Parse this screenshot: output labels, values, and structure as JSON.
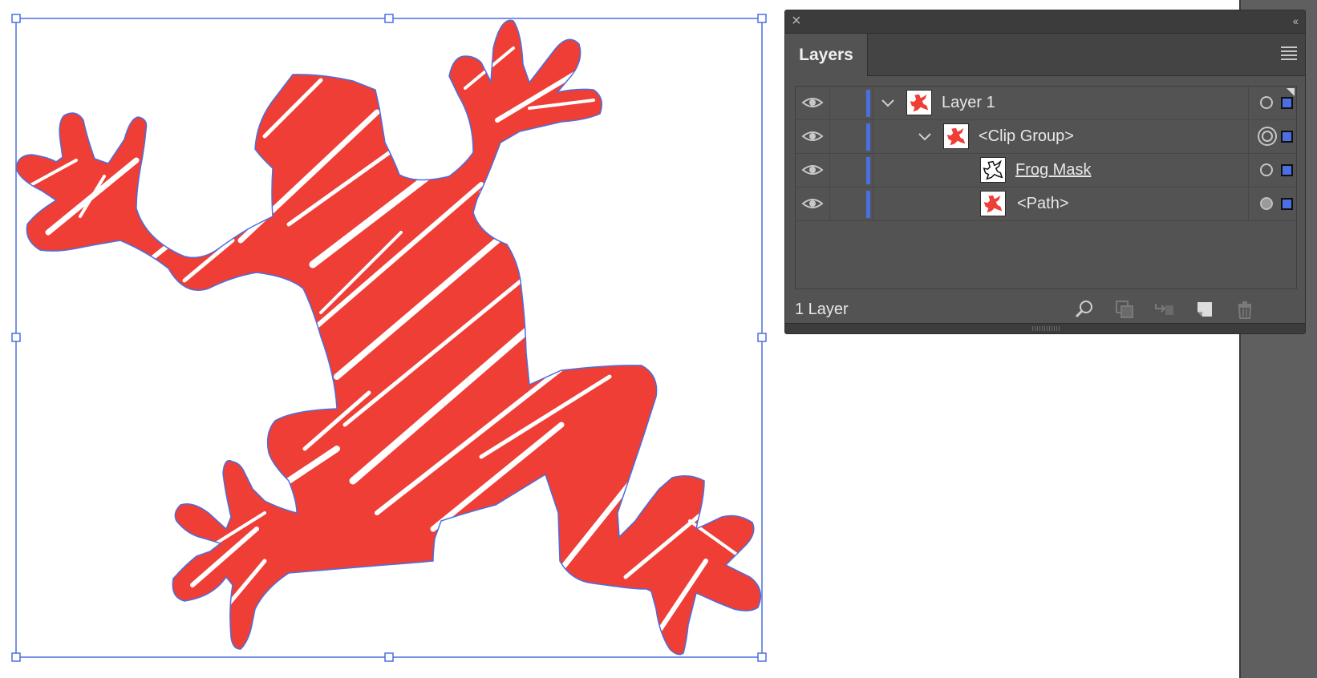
{
  "panel": {
    "tab_label": "Layers",
    "footer_count": "1 Layer",
    "layers": [
      {
        "label": "Layer 1",
        "level": 0,
        "expandable": true,
        "thumb": "frog-thumb",
        "target": "single",
        "corner_mark": true,
        "underline": false
      },
      {
        "label": "<Clip Group>",
        "level": 1,
        "expandable": true,
        "thumb": "frog-thumb",
        "target": "double",
        "corner_mark": false,
        "underline": false
      },
      {
        "label": "Frog Mask",
        "level": 2,
        "expandable": false,
        "thumb": "mask-thumb",
        "target": "single",
        "corner_mark": false,
        "underline": true
      },
      {
        "label": "<Path>",
        "level": 2,
        "expandable": false,
        "thumb": "frog-thumb",
        "target": "filled",
        "corner_mark": false,
        "underline": false
      }
    ],
    "footer_icons": [
      "locate-object-icon",
      "make-clipping-mask-icon",
      "move-to-layer-icon",
      "new-layer-icon",
      "delete-icon"
    ]
  },
  "colors": {
    "frog_fill": "#ef3e36",
    "selection": "#4a6fe0",
    "panel_bg": "#535353",
    "layer_color": "#4a6fe0"
  }
}
